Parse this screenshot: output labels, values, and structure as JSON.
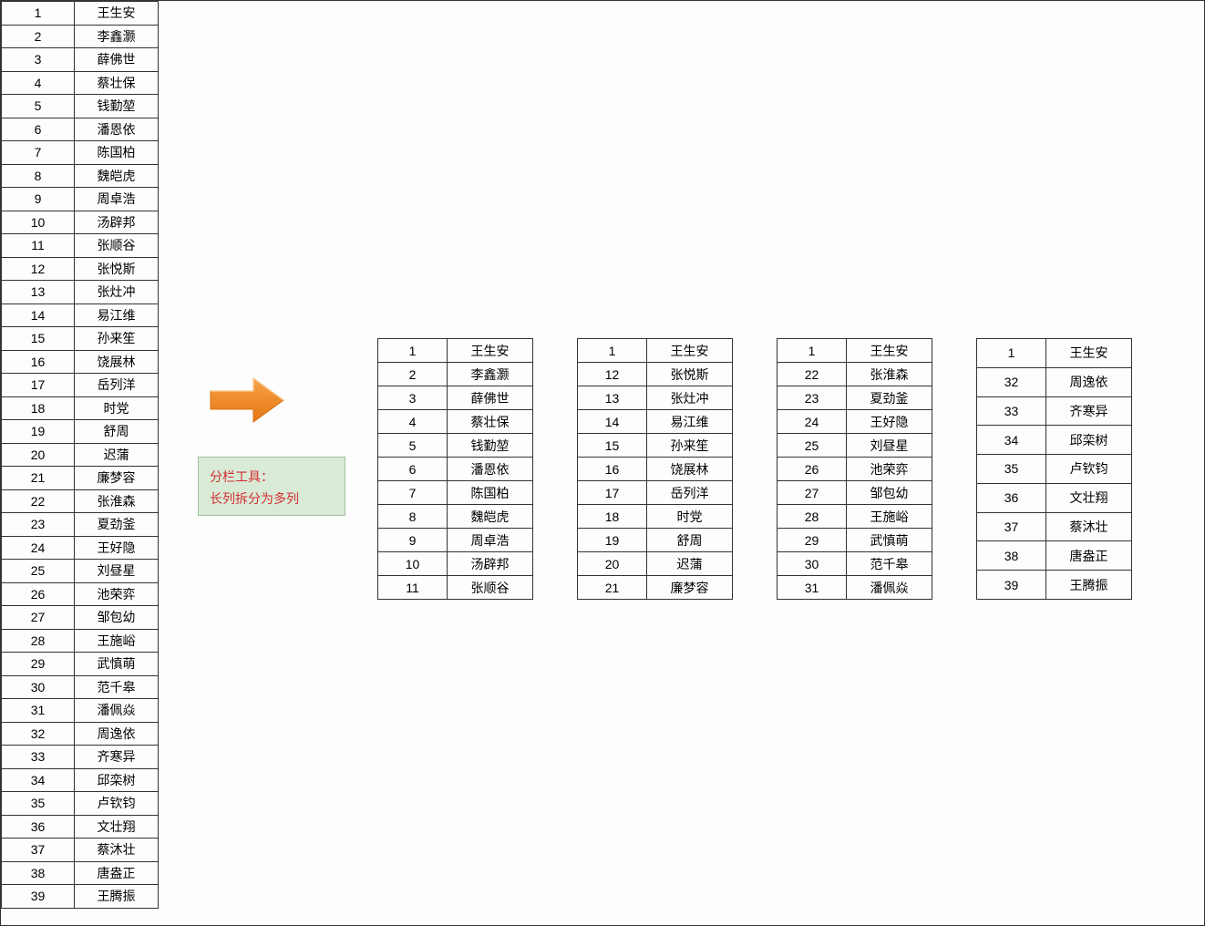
{
  "main_list": [
    {
      "num": "1",
      "name": "王生安"
    },
    {
      "num": "2",
      "name": "李鑫灏"
    },
    {
      "num": "3",
      "name": "薛佛世"
    },
    {
      "num": "4",
      "name": "蔡壮保"
    },
    {
      "num": "5",
      "name": "钱勤堃"
    },
    {
      "num": "6",
      "name": "潘恩依"
    },
    {
      "num": "7",
      "name": "陈国柏"
    },
    {
      "num": "8",
      "name": "魏皑虎"
    },
    {
      "num": "9",
      "name": "周卓浩"
    },
    {
      "num": "10",
      "name": "汤辟邦"
    },
    {
      "num": "11",
      "name": "张顺谷"
    },
    {
      "num": "12",
      "name": "张悦斯"
    },
    {
      "num": "13",
      "name": "张灶冲"
    },
    {
      "num": "14",
      "name": "易江维"
    },
    {
      "num": "15",
      "name": "孙来笙"
    },
    {
      "num": "16",
      "name": "饶展林"
    },
    {
      "num": "17",
      "name": "岳列洋"
    },
    {
      "num": "18",
      "name": "时党"
    },
    {
      "num": "19",
      "name": "舒周"
    },
    {
      "num": "20",
      "name": "迟蒲"
    },
    {
      "num": "21",
      "name": "廉梦容"
    },
    {
      "num": "22",
      "name": "张淮森"
    },
    {
      "num": "23",
      "name": "夏劲釜"
    },
    {
      "num": "24",
      "name": "王好隐"
    },
    {
      "num": "25",
      "name": "刘昼星"
    },
    {
      "num": "26",
      "name": "池荣弈"
    },
    {
      "num": "27",
      "name": "邹包幼"
    },
    {
      "num": "28",
      "name": "王施峪"
    },
    {
      "num": "29",
      "name": "武慎萌"
    },
    {
      "num": "30",
      "name": "范千皋"
    },
    {
      "num": "31",
      "name": "潘佩焱"
    },
    {
      "num": "32",
      "name": "周逸依"
    },
    {
      "num": "33",
      "name": "齐寒异"
    },
    {
      "num": "34",
      "name": "邱栾树"
    },
    {
      "num": "35",
      "name": "卢钦钧"
    },
    {
      "num": "36",
      "name": "文壮翔"
    },
    {
      "num": "37",
      "name": "蔡沐壮"
    },
    {
      "num": "38",
      "name": "唐盎正"
    },
    {
      "num": "39",
      "name": "王腾振"
    }
  ],
  "info_box": {
    "line1": "分栏工具：",
    "line2": "长列拆分为多列"
  },
  "split_columns": [
    [
      {
        "num": "1",
        "name": "王生安"
      },
      {
        "num": "2",
        "name": "李鑫灏"
      },
      {
        "num": "3",
        "name": "薛佛世"
      },
      {
        "num": "4",
        "name": "蔡壮保"
      },
      {
        "num": "5",
        "name": "钱勤堃"
      },
      {
        "num": "6",
        "name": "潘恩依"
      },
      {
        "num": "7",
        "name": "陈国柏"
      },
      {
        "num": "8",
        "name": "魏皑虎"
      },
      {
        "num": "9",
        "name": "周卓浩"
      },
      {
        "num": "10",
        "name": "汤辟邦"
      },
      {
        "num": "11",
        "name": "张顺谷"
      }
    ],
    [
      {
        "num": "1",
        "name": "王生安"
      },
      {
        "num": "12",
        "name": "张悦斯"
      },
      {
        "num": "13",
        "name": "张灶冲"
      },
      {
        "num": "14",
        "name": "易江维"
      },
      {
        "num": "15",
        "name": "孙来笙"
      },
      {
        "num": "16",
        "name": "饶展林"
      },
      {
        "num": "17",
        "name": "岳列洋"
      },
      {
        "num": "18",
        "name": "时党"
      },
      {
        "num": "19",
        "name": "舒周"
      },
      {
        "num": "20",
        "name": "迟蒲"
      },
      {
        "num": "21",
        "name": "廉梦容"
      }
    ],
    [
      {
        "num": "1",
        "name": "王生安"
      },
      {
        "num": "22",
        "name": "张淮森"
      },
      {
        "num": "23",
        "name": "夏劲釜"
      },
      {
        "num": "24",
        "name": "王好隐"
      },
      {
        "num": "25",
        "name": "刘昼星"
      },
      {
        "num": "26",
        "name": "池荣弈"
      },
      {
        "num": "27",
        "name": "邹包幼"
      },
      {
        "num": "28",
        "name": "王施峪"
      },
      {
        "num": "29",
        "name": "武慎萌"
      },
      {
        "num": "30",
        "name": "范千皋"
      },
      {
        "num": "31",
        "name": "潘佩焱"
      }
    ],
    [
      {
        "num": "1",
        "name": "王生安"
      },
      {
        "num": "32",
        "name": "周逸依"
      },
      {
        "num": "33",
        "name": "齐寒异"
      },
      {
        "num": "34",
        "name": "邱栾树"
      },
      {
        "num": "35",
        "name": "卢钦钧"
      },
      {
        "num": "36",
        "name": "文壮翔"
      },
      {
        "num": "37",
        "name": "蔡沐壮"
      },
      {
        "num": "38",
        "name": "唐盎正"
      },
      {
        "num": "39",
        "name": "王腾振"
      }
    ]
  ]
}
